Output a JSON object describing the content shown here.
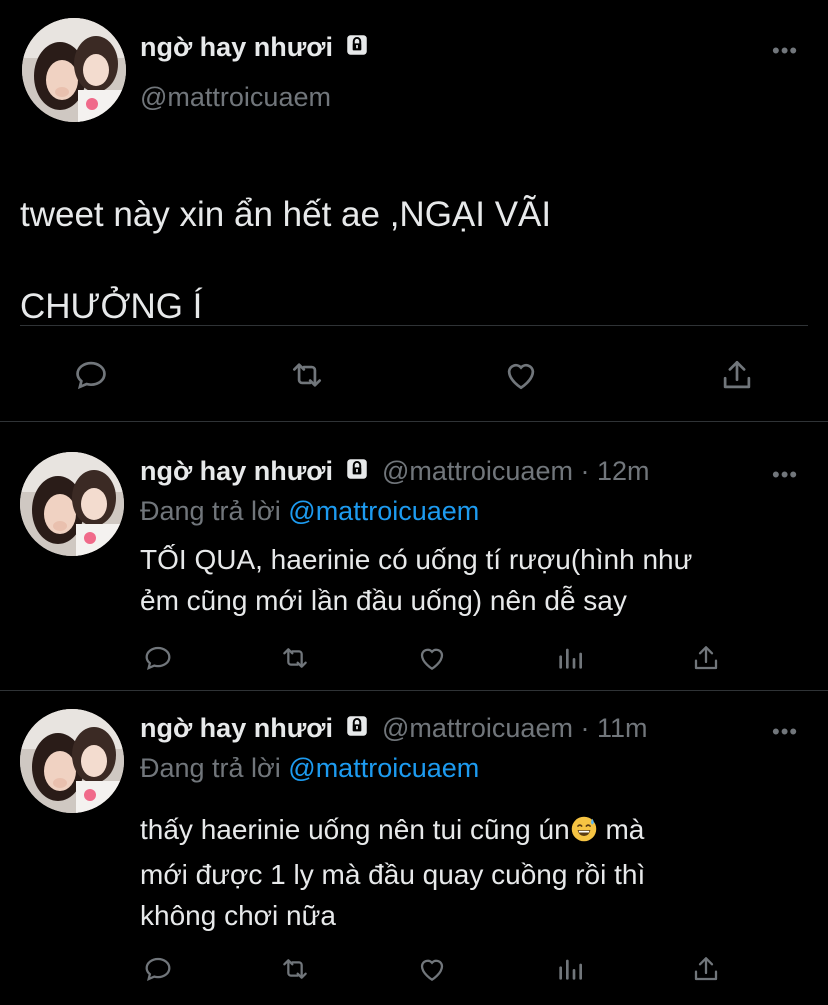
{
  "main_tweet": {
    "display_name": "ngờ hay nhươi",
    "handle": "@mattroicuaem",
    "text_line1": "tweet này xin ẩn hết ae ,NGẠI VÃI",
    "text_line2": "CHƯỞNG Í",
    "actions": [
      "reply-icon",
      "retweet-icon",
      "like-icon",
      "share-icon"
    ]
  },
  "replies": [
    {
      "display_name": "ngờ hay nhươi",
      "handle_time": "@mattroicuaem · 12m",
      "replying_prefix": "Đang trả lời",
      "replying_mention": "@mattroicuaem",
      "line1": "TỐI QUA, haerinie có uống tí rượu(hình như",
      "line2": "ẻm cũng mới lần đầu uống) nên dễ say",
      "actions": [
        "reply-icon",
        "retweet-icon",
        "like-icon",
        "analytics-icon",
        "share-icon"
      ]
    },
    {
      "display_name": "ngờ hay nhươi",
      "handle_time": "@mattroicuaem · 11m",
      "replying_prefix": "Đang trả lời",
      "replying_mention": "@mattroicuaem",
      "line1": "thấy haerinie uống nên tui cũng ún",
      "line1_after_emoji": " mà",
      "line2": "mới được 1 ly mà đầu quay cuồng rồi thì",
      "line3": "không chơi nữa",
      "emoji": "grinning-face-with-sweat",
      "actions": [
        "reply-icon",
        "retweet-icon",
        "like-icon",
        "analytics-icon",
        "share-icon"
      ]
    }
  ],
  "colors": {
    "background": "#000000",
    "text": "#e7e9ea",
    "secondary": "#71767b",
    "link": "#1d9bf0",
    "divider": "#2f3336"
  }
}
